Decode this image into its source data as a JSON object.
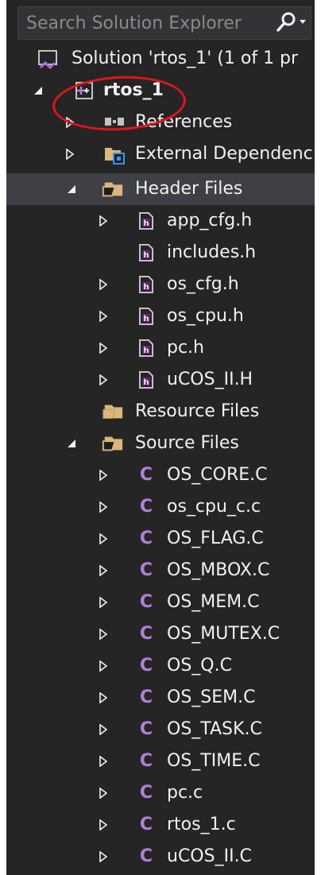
{
  "search": {
    "placeholder": "Search Solution Explorer",
    "icon": "search-icon",
    "dropdown_icon": "chevron-down-icon"
  },
  "tree": {
    "solution": {
      "label": "Solution 'rtos_1' (1 of 1 pr",
      "icon": "solution-icon"
    },
    "project": {
      "label": "rtos_1",
      "expanded": true,
      "icon": "cpp-project-icon"
    },
    "references": {
      "label": "References",
      "expanded": false,
      "icon": "references-icon"
    },
    "external": {
      "label": "External Dependenc",
      "expanded": false,
      "icon": "external-dependencies-icon"
    },
    "header_folder": {
      "label": "Header Files",
      "expanded": true,
      "selected": true,
      "icon": "filter-folder-icon"
    },
    "header_files": [
      {
        "label": "app_cfg.h",
        "has_expander": true
      },
      {
        "label": "includes.h",
        "has_expander": false
      },
      {
        "label": "os_cfg.h",
        "has_expander": true
      },
      {
        "label": "os_cpu.h",
        "has_expander": true
      },
      {
        "label": "pc.h",
        "has_expander": true
      },
      {
        "label": "uCOS_II.H",
        "has_expander": true
      }
    ],
    "resource_folder": {
      "label": "Resource Files",
      "icon": "filter-folder-icon"
    },
    "source_folder": {
      "label": "Source Files",
      "expanded": true,
      "icon": "filter-folder-icon"
    },
    "source_files": [
      {
        "label": "OS_CORE.C"
      },
      {
        "label": "os_cpu_c.c"
      },
      {
        "label": "OS_FLAG.C"
      },
      {
        "label": "OS_MBOX.C"
      },
      {
        "label": "OS_MEM.C"
      },
      {
        "label": "OS_MUTEX.C"
      },
      {
        "label": "OS_Q.C"
      },
      {
        "label": "OS_SEM.C"
      },
      {
        "label": "OS_TASK.C"
      },
      {
        "label": "OS_TIME.C"
      },
      {
        "label": "pc.c"
      },
      {
        "label": "rtos_1.c"
      },
      {
        "label": "uCOS_II.C"
      }
    ]
  },
  "colors": {
    "background": "#252526",
    "text": "#f1f1f1",
    "selected": "#3f3f46",
    "c_icon": "#b180d7",
    "annotation": "#e0151b"
  }
}
